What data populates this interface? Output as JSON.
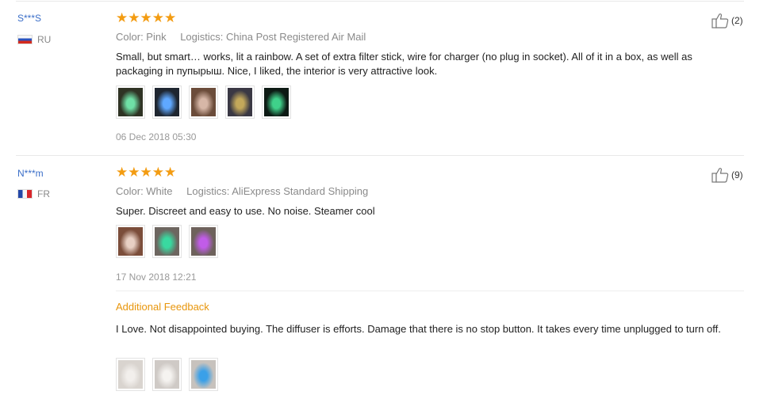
{
  "reviews": [
    {
      "user": "S***S",
      "country": "RU",
      "stars": "★★★★★",
      "color": "Color: Pink",
      "logistics": "Logistics: China Post Registered Air Mail",
      "text": "Small, but smart… works, lit a rainbow. A set of extra filter stick, wire for charger (no plug in socket). All of it in a box, as well as packaging in пупырыш. Nice, I liked, the interior is very attractive look.",
      "photos": [
        {
          "tone": "#2f3324",
          "accent": "#6fe0a6"
        },
        {
          "tone": "#1f2630",
          "accent": "#5fa8ff"
        },
        {
          "tone": "#6b4c3a",
          "accent": "#d7b7a7"
        },
        {
          "tone": "#3a3844",
          "accent": "#c3a85a"
        },
        {
          "tone": "#0d1a14",
          "accent": "#3fd18a"
        }
      ],
      "date": "06 Dec 2018 05:30",
      "likes": "(2)"
    },
    {
      "user": "N***m",
      "country": "FR",
      "stars": "★★★★★",
      "color": "Color: White",
      "logistics": "Logistics: AliExpress Standard Shipping",
      "text": "Super. Discreet and easy to use. No noise. Steamer cool",
      "photos": [
        {
          "tone": "#7b4d3a",
          "accent": "#e8d0c4"
        },
        {
          "tone": "#6d6660",
          "accent": "#39d9a0"
        },
        {
          "tone": "#6e625c",
          "accent": "#c15ce8"
        }
      ],
      "date": "17 Nov 2018 12:21",
      "additional_label": "Additional Feedback",
      "additional_text": "I Love. Not disappointed buying. The diffuser is efforts. Damage that there is no stop button. It takes every time unplugged to turn off.",
      "additional_photos": [
        {
          "tone": "#d9d4cf",
          "accent": "#f2efec"
        },
        {
          "tone": "#cfcac6",
          "accent": "#f5f3f0"
        },
        {
          "tone": "#c7c2bd",
          "accent": "#3aa0e8"
        }
      ],
      "likes": "(9)"
    }
  ]
}
